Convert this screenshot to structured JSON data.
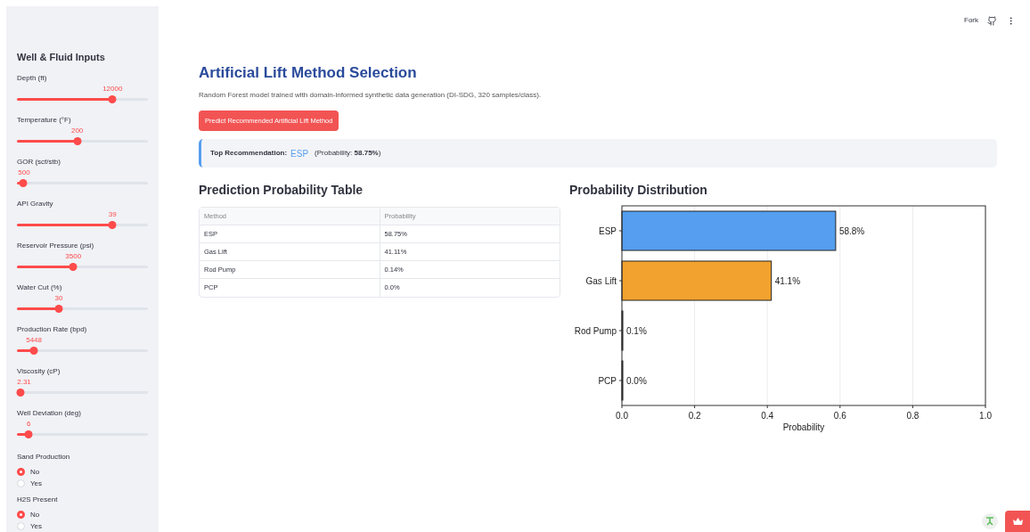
{
  "header": {
    "fork_label": "Fork"
  },
  "sidebar": {
    "title": "Well & Fluid Inputs",
    "sliders": [
      {
        "label": "Depth (ft)",
        "value": "12000",
        "level": 0.73
      },
      {
        "label": "Temperature (°F)",
        "value": "200",
        "level": 0.46
      },
      {
        "label": "GOR (scf/stb)",
        "value": "500",
        "level": 0.05
      },
      {
        "label": "API Gravity",
        "value": "39",
        "level": 0.73
      },
      {
        "label": "Reservoir Pressure (psi)",
        "value": "3500",
        "level": 0.43
      },
      {
        "label": "Water Cut (%)",
        "value": "30",
        "level": 0.32
      },
      {
        "label": "Production Rate (bpd)",
        "value": "5448",
        "level": 0.13
      },
      {
        "label": "Viscosity (cP)",
        "value": "2.31",
        "level": 0.03
      },
      {
        "label": "Well Deviation (deg)",
        "value": "6",
        "level": 0.09
      }
    ],
    "radio_groups": [
      {
        "label": "Sand Production",
        "options": [
          {
            "label": "No",
            "selected": true
          },
          {
            "label": "Yes",
            "selected": false
          }
        ]
      },
      {
        "label": "H2S Present",
        "options": [
          {
            "label": "No",
            "selected": true
          },
          {
            "label": "Yes",
            "selected": false
          }
        ]
      }
    ]
  },
  "main": {
    "title": "Artificial Lift Method Selection",
    "subtitle": "Random Forest model trained with domain-informed synthetic data generation (DI-SDG, 320 samples/class).",
    "predict_button": "Predict Recommended Artificial Lift Method",
    "recommendation": {
      "label": "Top Recommendation:",
      "method": "ESP",
      "probability": "(Probability: **58.75%**)"
    },
    "table": {
      "title": "Prediction Probability Table",
      "columns": [
        "Method",
        "Probability"
      ],
      "rows": [
        [
          "ESP",
          "58.75%"
        ],
        [
          "Gas Lift",
          "41.11%"
        ],
        [
          "Rod Pump",
          "0.14%"
        ],
        [
          "PCP",
          "0.0%"
        ]
      ]
    },
    "chart": {
      "title": "Probability Distribution",
      "chart_data": {
        "type": "bar",
        "orientation": "horizontal",
        "xlabel": "Probability",
        "categories": [
          "ESP",
          "Gas Lift",
          "Rod Pump",
          "PCP"
        ],
        "series": [
          {
            "values": [
              0.588,
              0.411,
              0.001,
              0.0
            ]
          }
        ],
        "colors": [
          "#559ef0",
          "#f2a22e"
        ],
        "grid": true,
        "xlim": [
          0,
          1
        ],
        "xticks": [
          {
            "value": 0,
            "label": "0.0"
          },
          {
            "value": 0.2,
            "label": "0.2"
          },
          {
            "value": 0.4,
            "label": "0.4"
          },
          {
            "value": 0.6,
            "label": "0.6"
          },
          {
            "value": 0.8,
            "label": "0.8"
          },
          {
            "value": 1,
            "label": "1.0"
          }
        ],
        "value_labels": [
          "58.8%",
          "41.1%",
          "0.1%",
          "0.0%"
        ]
      }
    }
  }
}
